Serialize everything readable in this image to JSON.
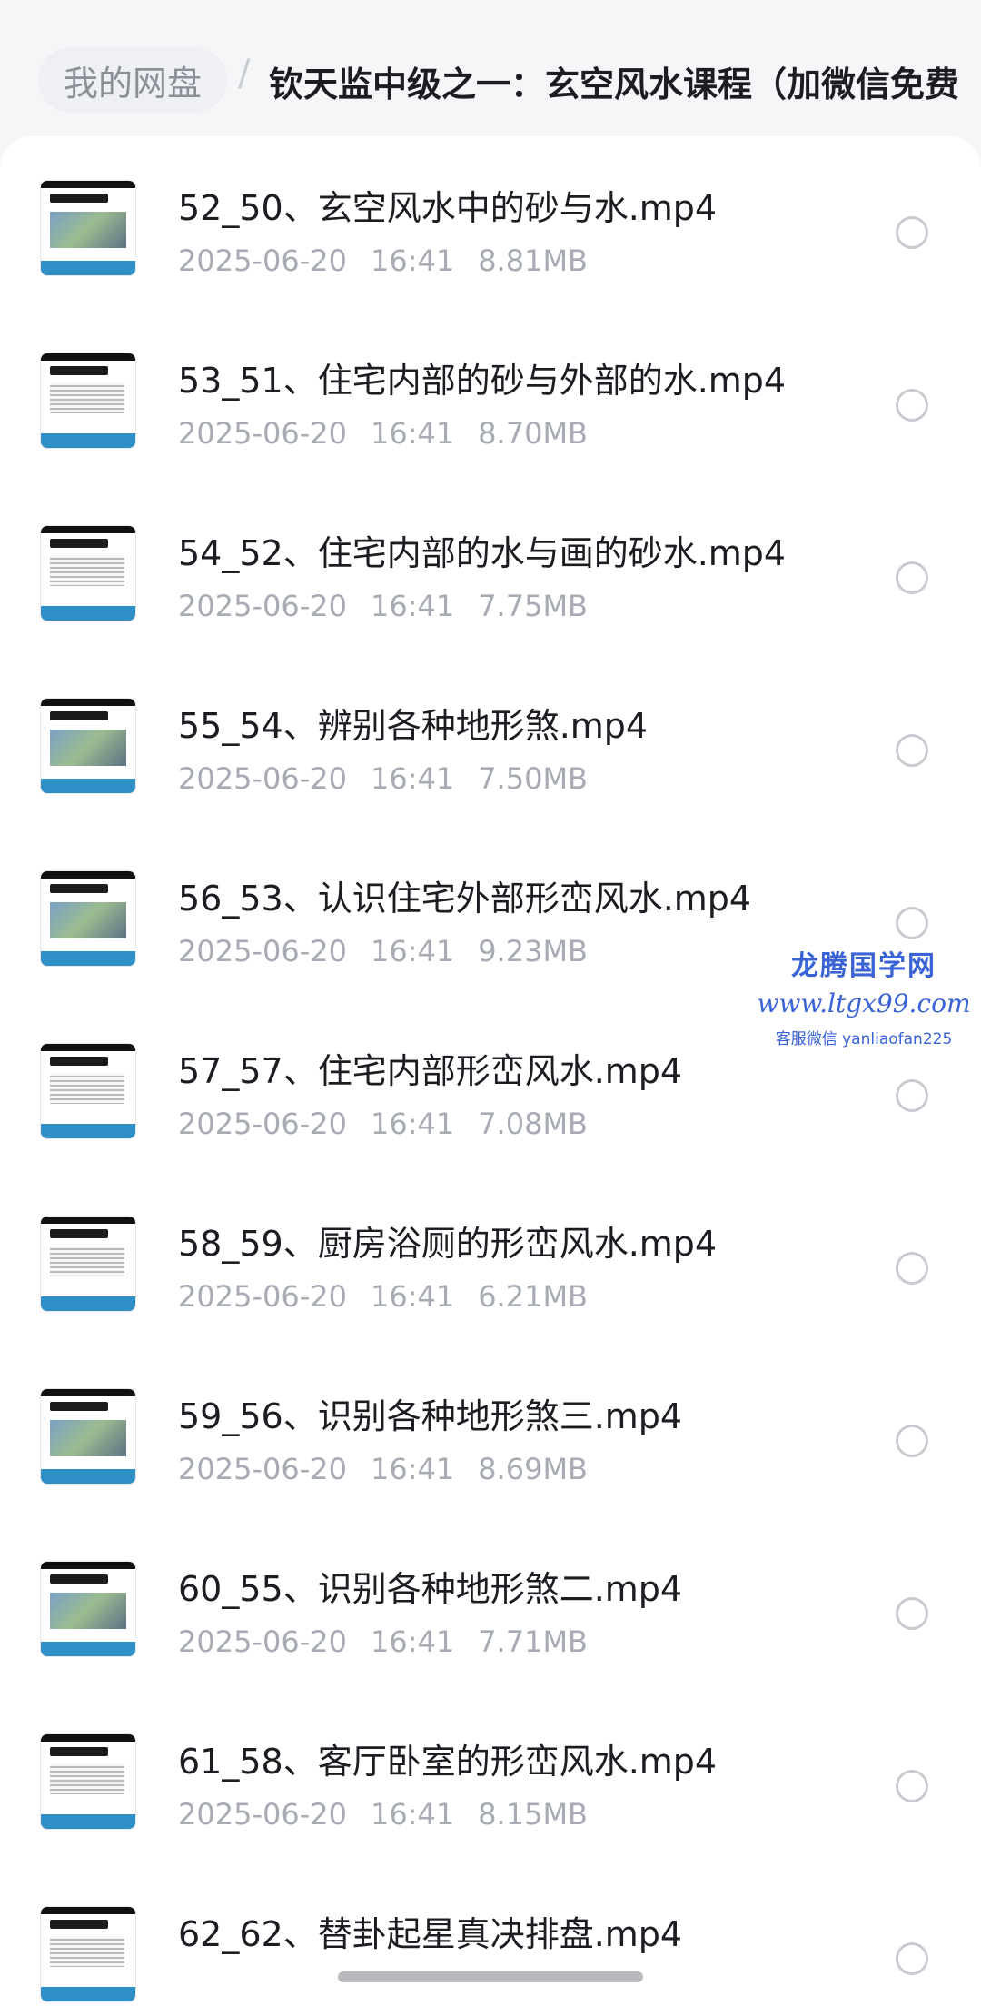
{
  "breadcrumb": {
    "root": "我的网盘",
    "separator": "/",
    "current": "钦天监中级之一：玄空风水课程（加微信免费"
  },
  "files": [
    {
      "name": "52_50、玄空风水中的砂与水.mp4",
      "date": "2025-06-20",
      "time": "16:41",
      "size": "8.81MB",
      "thumb_style": "image"
    },
    {
      "name": "53_51、住宅内部的砂与外部的水.mp4",
      "date": "2025-06-20",
      "time": "16:41",
      "size": "8.70MB",
      "thumb_style": "text"
    },
    {
      "name": "54_52、住宅内部的水与画的砂水.mp4",
      "date": "2025-06-20",
      "time": "16:41",
      "size": "7.75MB",
      "thumb_style": "text"
    },
    {
      "name": "55_54、辨别各种地形煞.mp4",
      "date": "2025-06-20",
      "time": "16:41",
      "size": "7.50MB",
      "thumb_style": "image"
    },
    {
      "name": "56_53、认识住宅外部形峦风水.mp4",
      "date": "2025-06-20",
      "time": "16:41",
      "size": "9.23MB",
      "thumb_style": "image"
    },
    {
      "name": "57_57、住宅内部形峦风水.mp4",
      "date": "2025-06-20",
      "time": "16:41",
      "size": "7.08MB",
      "thumb_style": "text"
    },
    {
      "name": "58_59、厨房浴厕的形峦风水.mp4",
      "date": "2025-06-20",
      "time": "16:41",
      "size": "6.21MB",
      "thumb_style": "text"
    },
    {
      "name": "59_56、识别各种地形煞三.mp4",
      "date": "2025-06-20",
      "time": "16:41",
      "size": "8.69MB",
      "thumb_style": "image"
    },
    {
      "name": "60_55、识别各种地形煞二.mp4",
      "date": "2025-06-20",
      "time": "16:41",
      "size": "7.71MB",
      "thumb_style": "image"
    },
    {
      "name": "61_58、客厅卧室的形峦风水.mp4",
      "date": "2025-06-20",
      "time": "16:41",
      "size": "8.15MB",
      "thumb_style": "text"
    },
    {
      "name": "62_62、替卦起星真决排盘.mp4",
      "date": "",
      "time": "",
      "size": "",
      "thumb_style": "text"
    }
  ],
  "watermark": {
    "name": "龙腾国学网",
    "site": "www.ltgx99.com",
    "contact": "客服微信 yanliaofan225"
  },
  "colors": {
    "background": "#f5f6f8",
    "sheet": "#ffffff",
    "primary_text": "#1b1d22",
    "secondary_text": "#a7abb3",
    "watermark": "#3a63d6"
  }
}
